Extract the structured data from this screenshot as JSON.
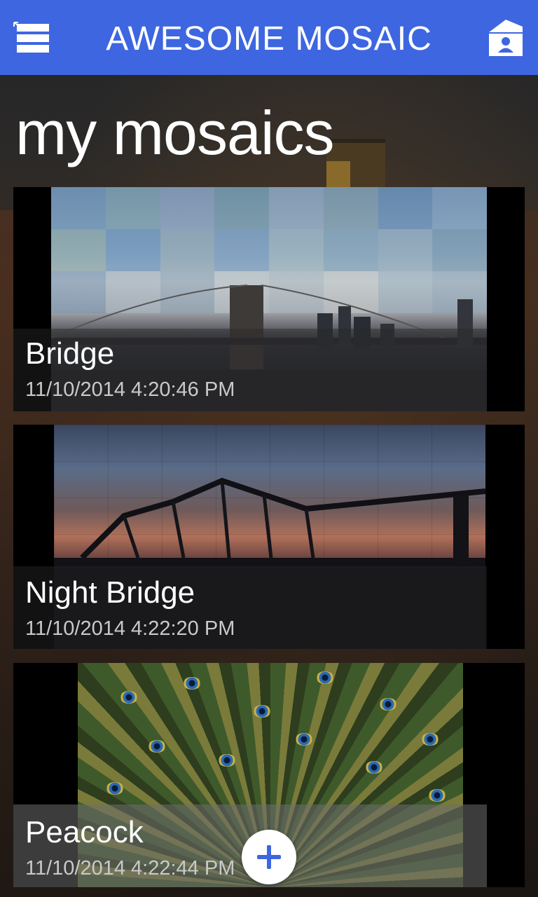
{
  "header": {
    "title": "AWESOME MOSAIC",
    "menu_icon": "hamburger-menu-icon",
    "profile_icon": "profile-card-icon",
    "color": "#3d66e0"
  },
  "page": {
    "title": "my mosaics"
  },
  "mosaics": [
    {
      "name": "Bridge",
      "date": "11/10/2014 4:20:46 PM"
    },
    {
      "name": "Night Bridge",
      "date": "11/10/2014 4:22:20 PM"
    },
    {
      "name": "Peacock",
      "date": "11/10/2014 4:22:44 PM"
    }
  ],
  "fab": {
    "icon": "plus-icon"
  }
}
